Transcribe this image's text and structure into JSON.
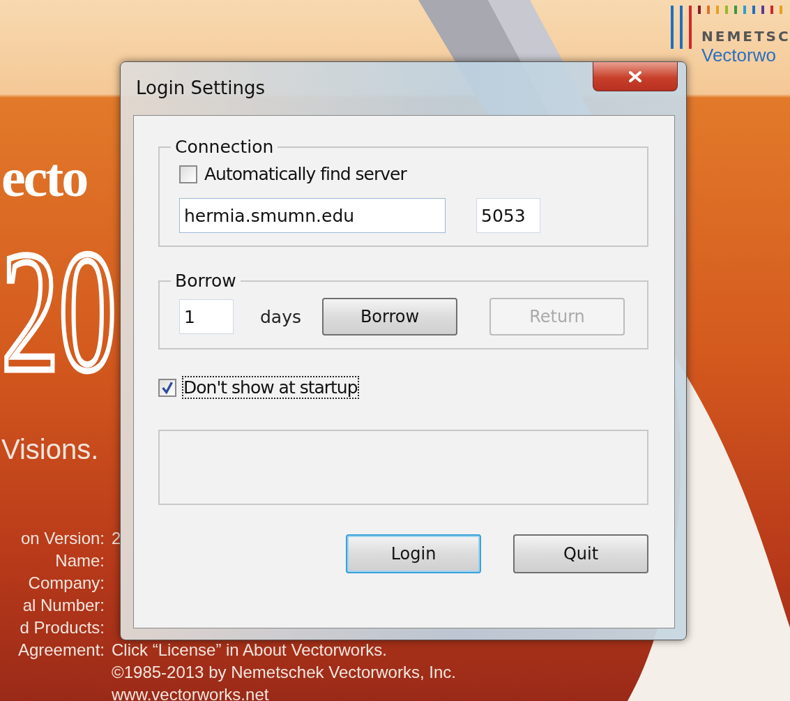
{
  "splash": {
    "logo": {
      "company": "NEMETSC",
      "product": "Vectorwo"
    },
    "title": "ecto",
    "version_number": "20",
    "tagline": "Visions.",
    "info": [
      {
        "label": "on Version:",
        "value": "2"
      },
      {
        "label": "Name:"
      },
      {
        "label": "Company:"
      },
      {
        "label": "al Number:"
      },
      {
        "label": "d Products:"
      },
      {
        "label": "Agreement:",
        "value": "Click “License” in About Vectorworks."
      }
    ],
    "copyright": "©1985-2013 by Nemetschek Vectorworks, Inc.",
    "website": "www.vectorworks.net"
  },
  "dialog": {
    "title": "Login Settings",
    "connection": {
      "legend": "Connection",
      "auto_find": {
        "label": "Automatically find server",
        "checked": false
      },
      "server": "hermia.smumn.edu",
      "port": "5053"
    },
    "borrow": {
      "legend": "Borrow",
      "days": "1",
      "days_label": "days",
      "buttons": [
        {
          "label": "Borrow",
          "disabled": false
        },
        {
          "label": "Return",
          "disabled": true
        }
      ]
    },
    "dont_show": {
      "label": "Don't show at startup",
      "checked": true,
      "focused": true
    },
    "buttons": [
      {
        "label": "Login",
        "default": true
      },
      {
        "label": "Quit",
        "default": false
      }
    ]
  }
}
